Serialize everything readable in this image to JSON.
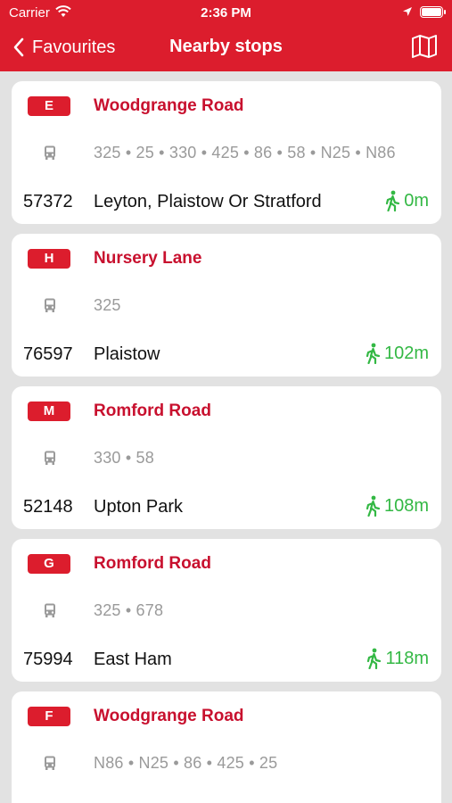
{
  "status_bar": {
    "carrier": "Carrier",
    "time": "2:36 PM"
  },
  "nav": {
    "back_label": "Favourites",
    "title": "Nearby stops"
  },
  "colors": {
    "brand_red": "#dc1d2d",
    "walk_green": "#33b844"
  },
  "stops": [
    {
      "letter": "E",
      "name": "Woodgrange Road",
      "routes": "325 • 25 • 330 • 425 • 86 • 58 • N25 • N86",
      "code": "57372",
      "destination": "Leyton, Plaistow Or Stratford",
      "distance": "0m"
    },
    {
      "letter": "H",
      "name": "Nursery Lane",
      "routes": "325",
      "code": "76597",
      "destination": "Plaistow",
      "distance": "102m"
    },
    {
      "letter": "M",
      "name": "Romford Road",
      "routes": "330 • 58",
      "code": "52148",
      "destination": "Upton Park",
      "distance": "108m"
    },
    {
      "letter": "G",
      "name": "Romford Road",
      "routes": "325 • 678",
      "code": "75994",
      "destination": "East Ham",
      "distance": "118m"
    },
    {
      "letter": "F",
      "name": "Woodgrange Road",
      "routes": "N86 • N25 • 86 • 425 • 25",
      "code": "",
      "destination": "",
      "distance": ""
    }
  ]
}
